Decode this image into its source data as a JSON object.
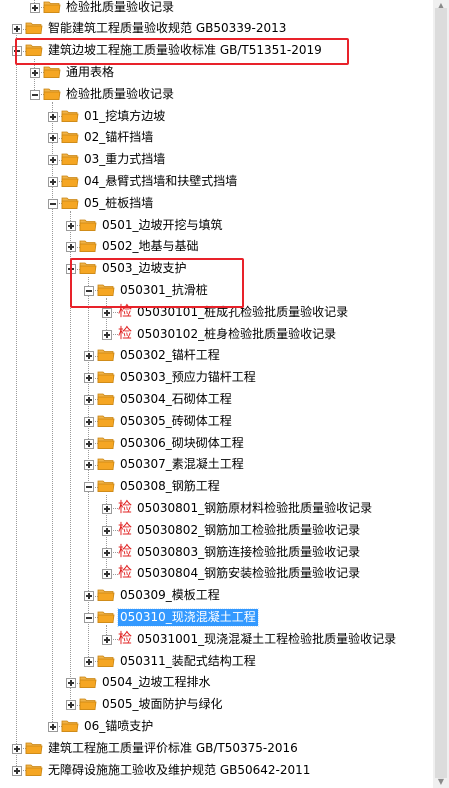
{
  "tree": {
    "nodes": [
      {
        "label": "检验批质量验收记录",
        "level": 2,
        "kind": "folder",
        "state": "collapsed"
      },
      {
        "label": "智能建筑工程质量验收规范 GB50339-2013",
        "level": 1,
        "kind": "folder",
        "state": "collapsed"
      },
      {
        "label": "建筑边坡工程施工质量验收标准 GB/T51351-2019",
        "level": 1,
        "kind": "folder",
        "state": "expanded"
      },
      {
        "label": "通用表格",
        "level": 2,
        "kind": "folder",
        "state": "collapsed"
      },
      {
        "label": "检验批质量验收记录",
        "level": 2,
        "kind": "folder",
        "state": "expanded"
      },
      {
        "label": "01_挖填方边坡",
        "level": 3,
        "kind": "folder",
        "state": "collapsed"
      },
      {
        "label": "02_锚杆挡墙",
        "level": 3,
        "kind": "folder",
        "state": "collapsed"
      },
      {
        "label": "03_重力式挡墙",
        "level": 3,
        "kind": "folder",
        "state": "collapsed"
      },
      {
        "label": "04_悬臂式挡墙和扶壁式挡墙",
        "level": 3,
        "kind": "folder",
        "state": "collapsed"
      },
      {
        "label": "05_桩板挡墙",
        "level": 3,
        "kind": "folder",
        "state": "expanded"
      },
      {
        "label": "0501_边坡开挖与填筑",
        "level": 4,
        "kind": "folder",
        "state": "collapsed"
      },
      {
        "label": "0502_地基与基础",
        "level": 4,
        "kind": "folder",
        "state": "collapsed"
      },
      {
        "label": "0503_边坡支护",
        "level": 4,
        "kind": "folder",
        "state": "expanded"
      },
      {
        "label": "050301_抗滑桩",
        "level": 5,
        "kind": "folder",
        "state": "expanded"
      },
      {
        "label": "05030101_桩成孔检验批质量验收记录",
        "level": 6,
        "kind": "form",
        "state": "collapsed"
      },
      {
        "label": "05030102_桩身检验批质量验收记录",
        "level": 6,
        "kind": "form",
        "state": "collapsed"
      },
      {
        "label": "050302_锚杆工程",
        "level": 5,
        "kind": "folder",
        "state": "collapsed"
      },
      {
        "label": "050303_预应力锚杆工程",
        "level": 5,
        "kind": "folder",
        "state": "collapsed"
      },
      {
        "label": "050304_石砌体工程",
        "level": 5,
        "kind": "folder",
        "state": "collapsed"
      },
      {
        "label": "050305_砖砌体工程",
        "level": 5,
        "kind": "folder",
        "state": "collapsed"
      },
      {
        "label": "050306_砌块砌体工程",
        "level": 5,
        "kind": "folder",
        "state": "collapsed"
      },
      {
        "label": "050307_素混凝土工程",
        "level": 5,
        "kind": "folder",
        "state": "collapsed"
      },
      {
        "label": "050308_钢筋工程",
        "level": 5,
        "kind": "folder",
        "state": "expanded"
      },
      {
        "label": "05030801_钢筋原材料检验批质量验收记录",
        "level": 6,
        "kind": "form",
        "state": "collapsed"
      },
      {
        "label": "05030802_钢筋加工检验批质量验收记录",
        "level": 6,
        "kind": "form",
        "state": "collapsed"
      },
      {
        "label": "05030803_钢筋连接检验批质量验收记录",
        "level": 6,
        "kind": "form",
        "state": "collapsed"
      },
      {
        "label": "05030804_钢筋安装检验批质量验收记录",
        "level": 6,
        "kind": "form",
        "state": "collapsed"
      },
      {
        "label": "050309_模板工程",
        "level": 5,
        "kind": "folder",
        "state": "collapsed"
      },
      {
        "label": "050310_现浇混凝土工程",
        "level": 5,
        "kind": "folder",
        "state": "expanded",
        "selected": true
      },
      {
        "label": "05031001_现浇混凝土工程检验批质量验收记录",
        "level": 6,
        "kind": "form",
        "state": "collapsed"
      },
      {
        "label": "050311_装配式结构工程",
        "level": 5,
        "kind": "folder",
        "state": "collapsed"
      },
      {
        "label": "0504_边坡工程排水",
        "level": 4,
        "kind": "folder",
        "state": "collapsed"
      },
      {
        "label": "0505_坡面防护与绿化",
        "level": 4,
        "kind": "folder",
        "state": "collapsed"
      },
      {
        "label": "06_锚喷支护",
        "level": 3,
        "kind": "folder",
        "state": "collapsed"
      },
      {
        "label": "建筑工程施工质量评价标准 GB/T50375-2016",
        "level": 1,
        "kind": "folder",
        "state": "collapsed"
      },
      {
        "label": "无障碍设施施工验收及维护规范 GB50642-2011",
        "level": 1,
        "kind": "folder",
        "state": "collapsed"
      }
    ],
    "form_icon_glyph": "检"
  },
  "colors": {
    "folder_fill": "#f5a623",
    "folder_tab": "#f0b348",
    "selection_bg": "#3399ff",
    "highlight_box": "#e8222a",
    "form_glyph": "#e02020"
  },
  "scrollbar": {
    "up_arrow": "▲",
    "down_arrow": "▼"
  }
}
